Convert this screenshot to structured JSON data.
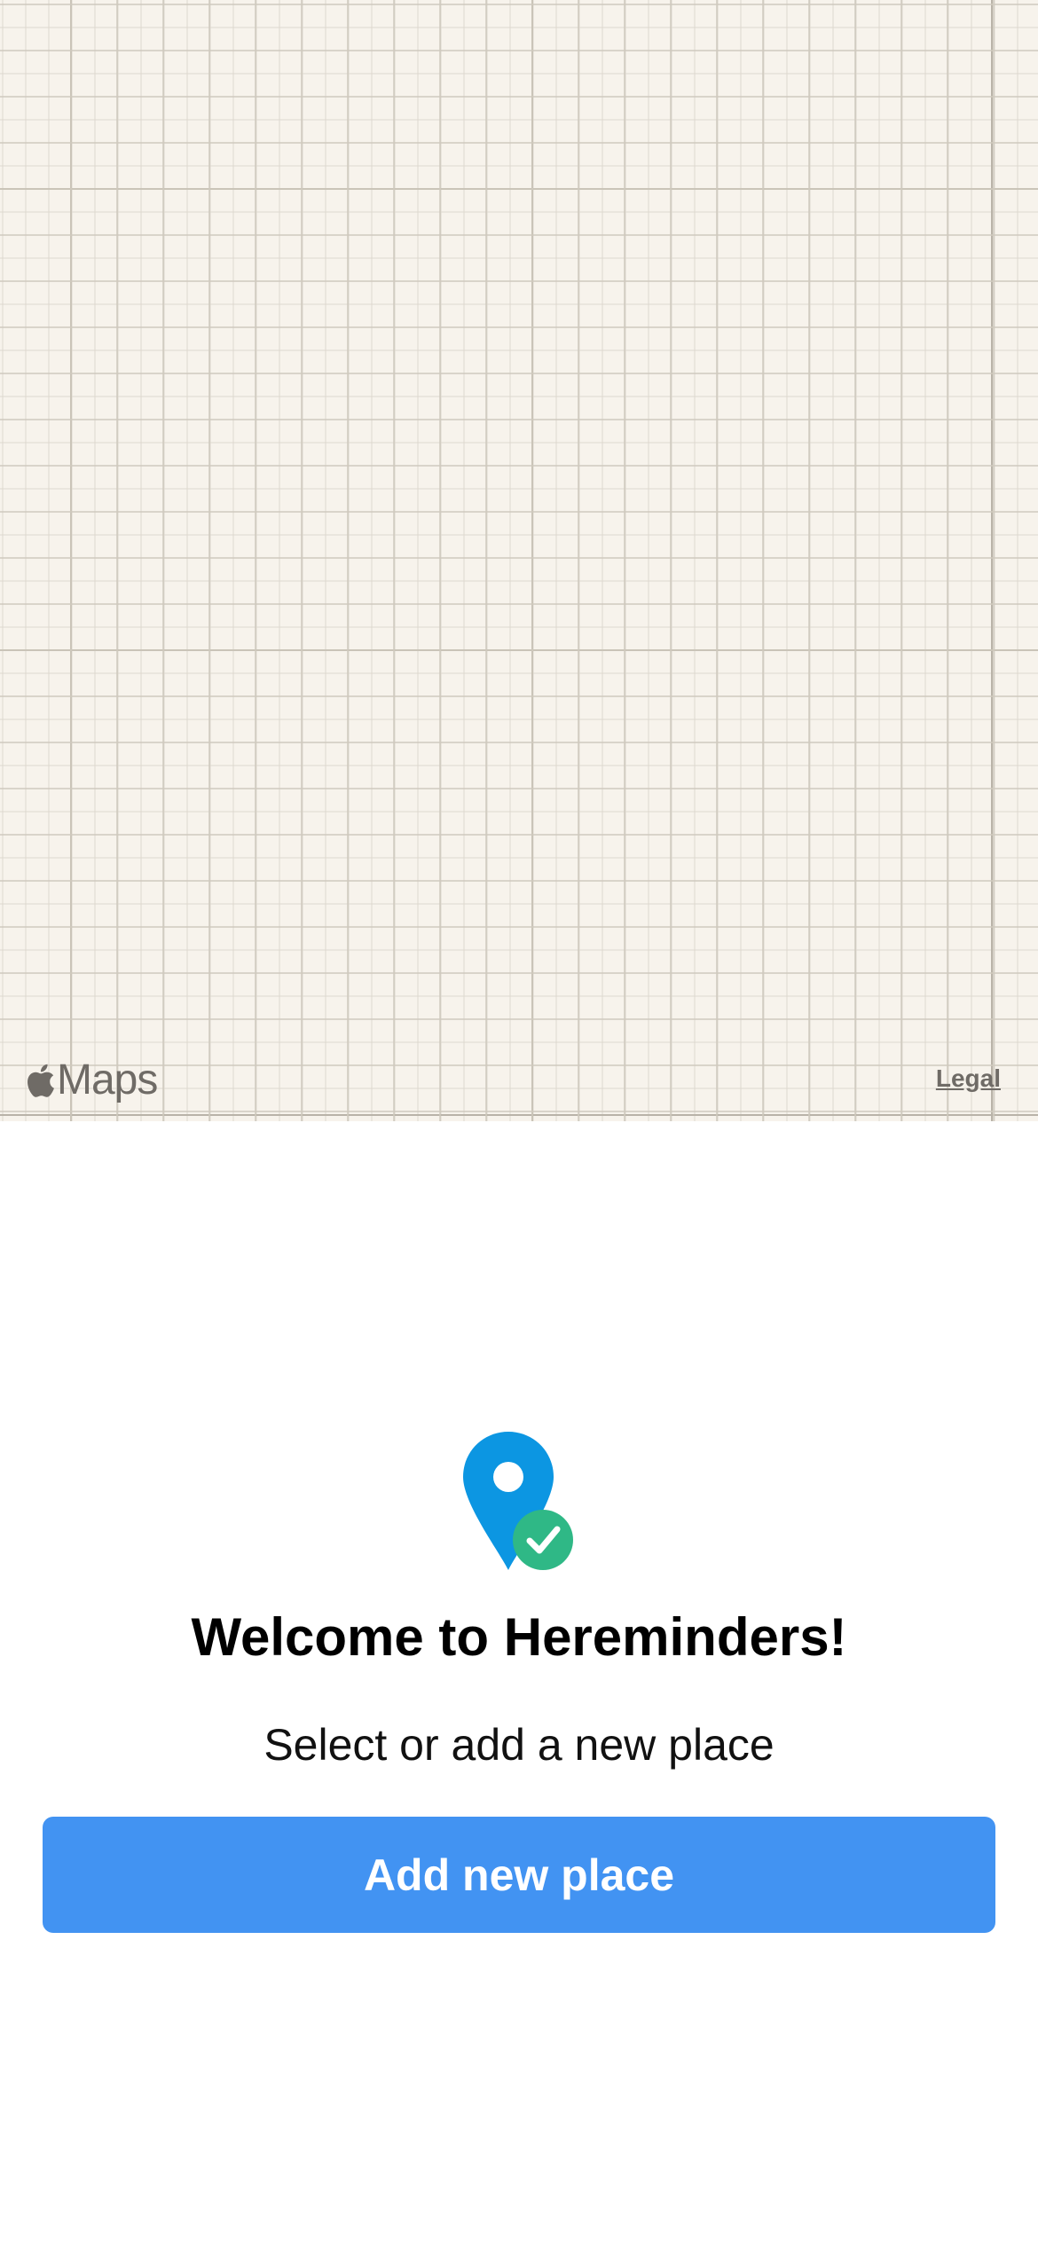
{
  "map": {
    "attribution": "Maps",
    "legal_label": "Legal",
    "background_color": "#f7f3ec",
    "icon": "apple-logo-icon"
  },
  "welcome": {
    "icon": "location-pin-check-icon",
    "title": "Welcome to Hereminders!",
    "subtitle": "Select or add a new place"
  },
  "actions": {
    "add_place_label": "Add new place",
    "accent_color": "#4293f2"
  },
  "colors": {
    "pin_blue": "#0c96e2",
    "check_green": "#2fb886"
  }
}
